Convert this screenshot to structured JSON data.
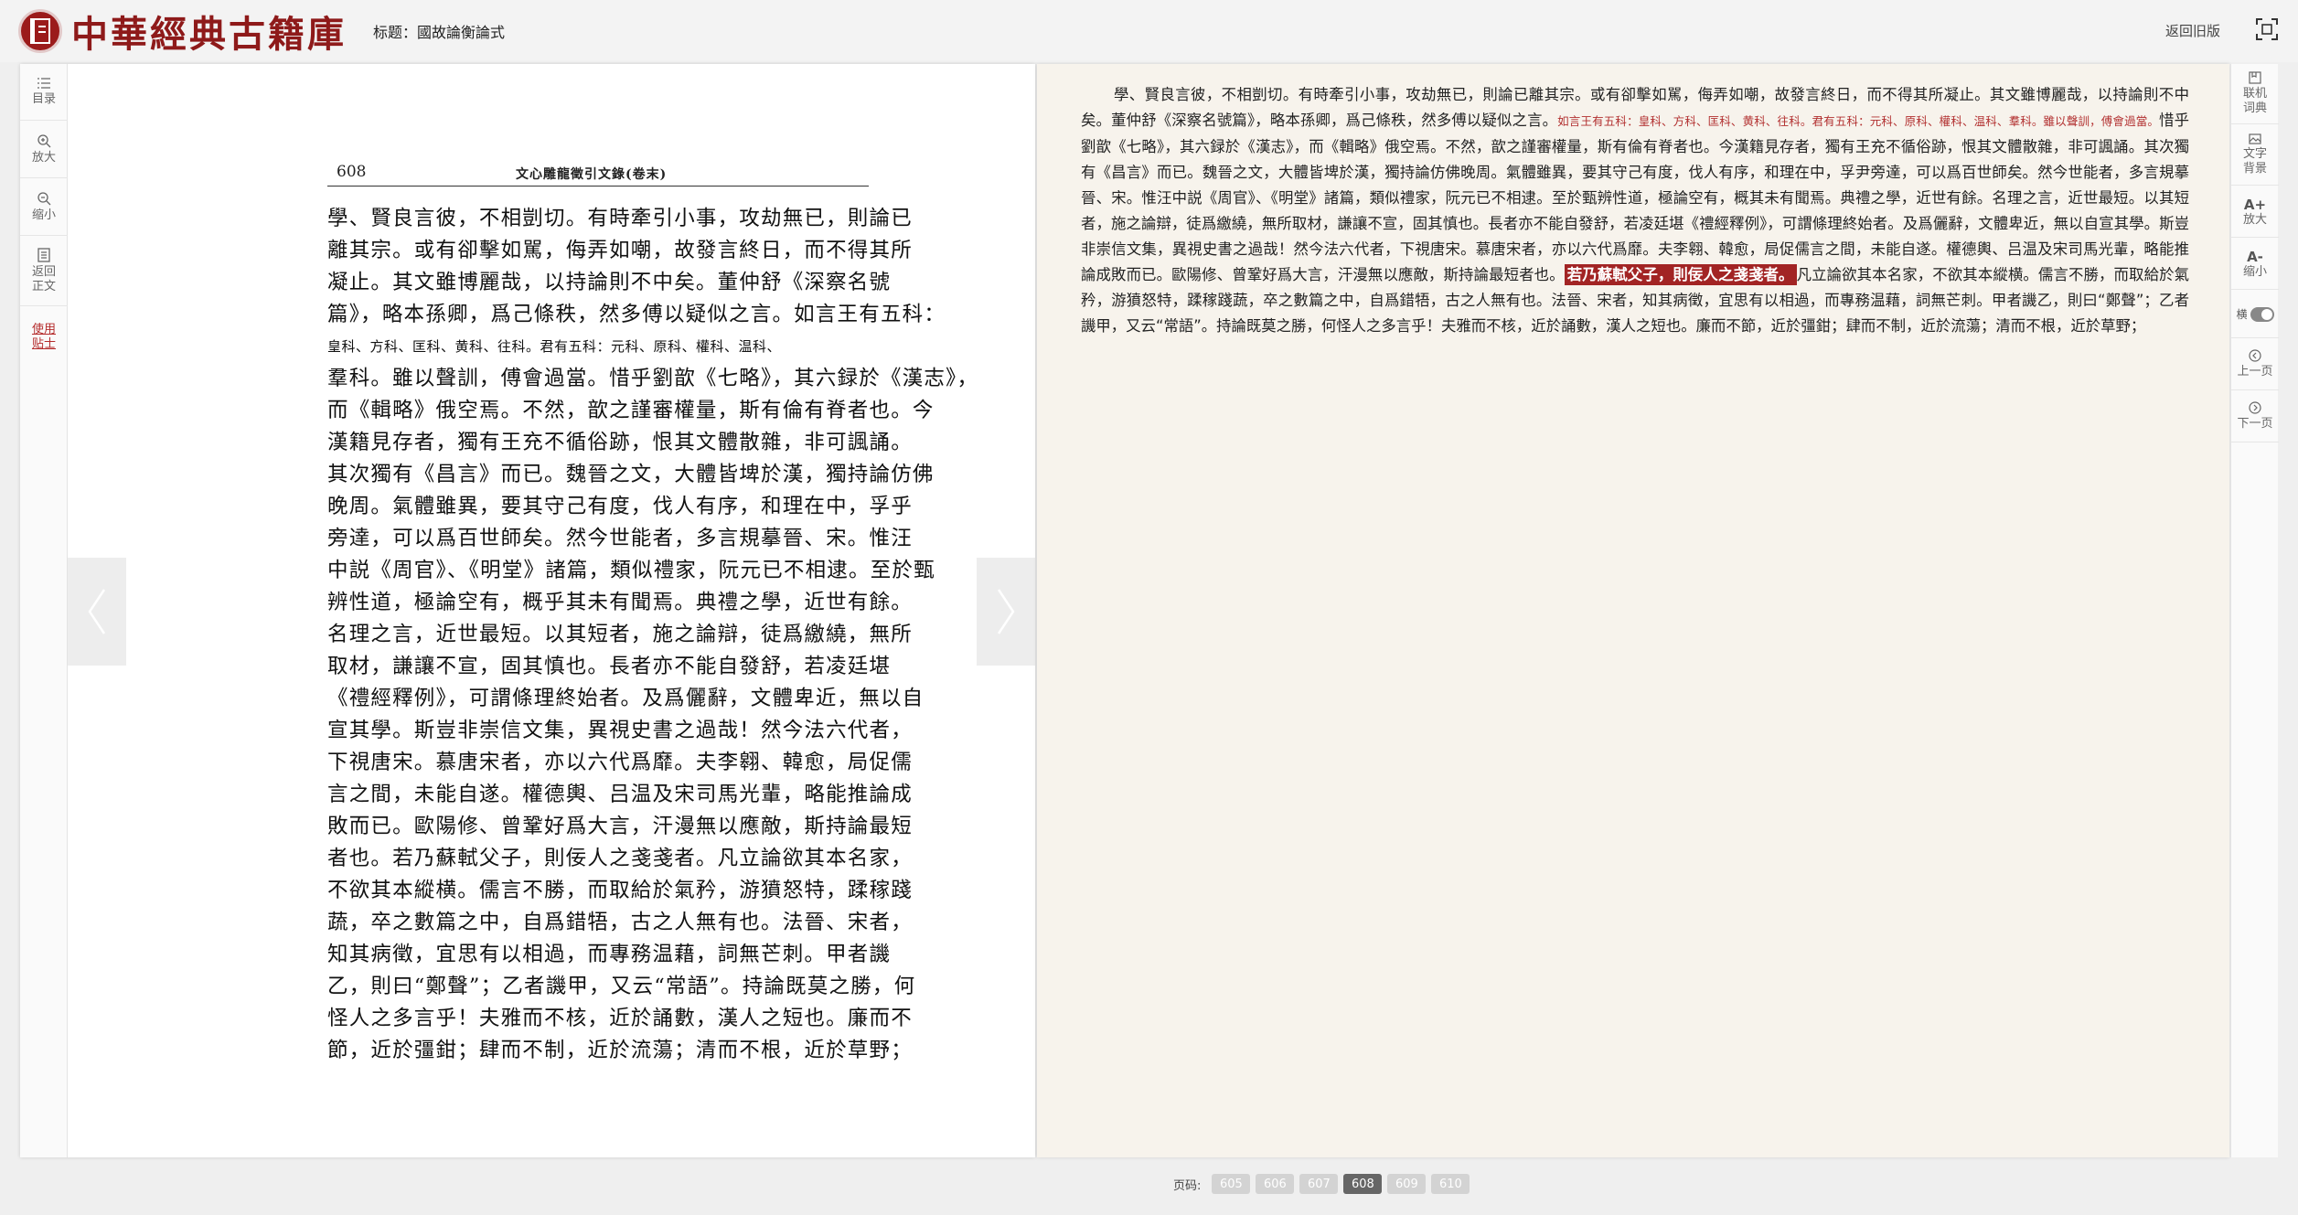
{
  "header": {
    "logo_text": "中華經典古籍庫",
    "doc_title": "标题：國故論衡論式",
    "back_old": "返回旧版"
  },
  "left_tools": [
    {
      "label": "目录",
      "icon": "list-icon"
    },
    {
      "label": "放大",
      "icon": "zoom-in-icon"
    },
    {
      "label": "缩小",
      "icon": "zoom-out-icon"
    },
    {
      "label": "返回\n正文",
      "icon": "return-icon"
    },
    {
      "label": "使用\n贴士",
      "icon": "tips"
    }
  ],
  "right_tools": [
    {
      "label": "联机\n词典",
      "icon": "dictionary-icon"
    },
    {
      "label": "文字\n背景",
      "icon": "background-icon"
    },
    {
      "label": "放大",
      "icon": "font-larger-icon"
    },
    {
      "label": "缩小",
      "icon": "font-smaller-icon"
    },
    {
      "label": "横",
      "icon": "orientation-toggle"
    },
    {
      "label": "上一页",
      "icon": "prev-page-icon"
    },
    {
      "label": "下一页",
      "icon": "next-page-icon"
    }
  ],
  "scan": {
    "page_number": "608",
    "running_head": "文心雕龍徵引文錄(卷末)",
    "lines": [
      "學、賢良言彼，不相剴切。有時牽引小事，攻劫無已，則論已",
      "離其宗。或有卻擊如駡，侮弄如嘲，故發言終日，而不得其所",
      "凝止。其文雖博麗哉，以持論則不中矣。董仲舒《深察名號",
      "篇》，略本孫卿，爲己條秩，然多傅以疑似之言。如言王有五科：",
      "皇科、方科、匡科、黄科、往科。君有五科：元科、原科、權科、温科、",
      "羣科。雖以聲訓，傅會過當。惜乎劉歆《七略》，其六録於《漢志》，",
      "而《輯略》俄空焉。不然，歆之謹審權量，斯有倫有脊者也。今",
      "漢籍見存者，獨有王充不循俗跡，恨其文體散雜，非可諷誦。",
      "其次獨有《昌言》而已。魏晉之文，大體皆埤於漢，獨持論仿佛",
      "晚周。氣體雖異，要其守己有度，伐人有序，和理在中，孚乎",
      "旁達，可以爲百世師矣。然今世能者，多言規摹晉、宋。惟汪",
      "中説《周官》、《明堂》諸篇，類似禮家，阮元已不相逮。至於甄",
      "辨性道，極論空有，概乎其未有聞焉。典禮之學，近世有餘。",
      "名理之言，近世最短。以其短者，施之論辯，徒爲繳繞，無所",
      "取材，謙讓不宣，固其慎也。長者亦不能自發舒，若凌廷堪",
      "《禮經釋例》，可謂條理終始者。及爲儷辭，文體卑近，無以自",
      "宣其學。斯豈非崇信文集，異視史書之過哉！然今法六代者，",
      "下視唐宋。慕唐宋者，亦以六代爲靡。夫李翱、韓愈，局促儒",
      "言之間，未能自遂。權德輿、吕温及宋司馬光輩，略能推論成",
      "敗而已。歐陽修、曾鞏好爲大言，汗漫無以應敵，斯持論最短",
      "者也。若乃蘇軾父子，則佞人之戔戔者。凡立論欲其本名家，",
      "不欲其本縱横。儒言不勝，而取給於氣矜，游獖怒特，蹂稼踐",
      "蔬，卒之數篇之中，自爲錯牾，古之人無有也。法晉、宋者，",
      "知其病徵，宜思有以相過，而專務温藉，詞無芒刺。甲者譏",
      "乙，則曰“鄭聲”；乙者譏甲，又云“常語”。持論既莫之勝，何",
      "怪人之多言乎！夫雅而不核，近於誦數，漢人之短也。廉而不",
      "節，近於彊鉗；肆而不制，近於流蕩；清而不根，近於草野；"
    ]
  },
  "text": {
    "part1": "學、賢良言彼，不相剴切。有時牽引小事，攻劫無已，則論已離其宗。或有卻擊如駡，侮弄如嘲，故發言終日，而不得其所凝止。其文雖博麗哉，以持論則不中矣。董仲舒《深察名號篇》，略本孫卿，爲己條秩，然多傅以疑似之言。",
    "note": "如言王有五科：皇科、方科、匡科、黄科、往科。君有五科：元科、原科、權科、温科、羣科。雖以聲訓，傅會過當。",
    "part2": "惜乎劉歆《七略》，其六録於《漢志》，而《輯略》俄空焉。不然，歆之謹審權量，斯有倫有脊者也。今漢籍見存者，獨有王充不循俗跡，恨其文體散雜，非可諷誦。其次獨有《昌言》而已。魏晉之文，大體皆埤於漢，獨持論仿佛晚周。氣體雖異，要其守己有度，伐人有序，和理在中，孚尹旁達，可以爲百世師矣。然今世能者，多言規摹晉、宋。惟汪中説《周官》、《明堂》諸篇，類似禮家，阮元已不相逮。至於甄辨性道，極論空有，概其未有聞焉。典禮之學，近世有餘。名理之言，近世最短。以其短者，施之論辯，徒爲繳繞，無所取材，謙讓不宣，固其慎也。長者亦不能自發舒，若凌廷堪《禮經釋例》，可謂條理終始者。及爲儷辭，文體卑近，無以自宣其學。斯豈非崇信文集，異視史書之過哉！然今法六代者，下視唐宋。慕唐宋者，亦以六代爲靡。夫李翱、韓愈，局促儒言之間，未能自遂。權德輿、吕温及宋司馬光輩，略能推論成敗而已。歐陽修、曾鞏好爲大言，汗漫無以應敵，斯持論最短者也。",
    "highlight": "若乃蘇軾父子，則佞人之戔戔者。",
    "part3": "凡立論欲其本名家，不欲其本縱横。儒言不勝，而取給於氣矜，游獖怒特，蹂稼踐蔬，卒之數篇之中，自爲錯牾，古之人無有也。法晉、宋者，知其病徵，宜思有以相過，而專務温藉，詞無芒刺。甲者譏乙，則曰“鄭聲”；乙者譏甲，又云“常語”。持論既莫之勝，何怪人之多言乎！夫雅而不核，近於誦數，漢人之短也。廉而不節，近於彊鉗；肆而不制，近於流蕩；清而不根，近於草野；"
  },
  "pager": {
    "label": "页码:",
    "pages": [
      "605",
      "606",
      "607",
      "608",
      "609",
      "610"
    ],
    "current": "608"
  },
  "colors": {
    "brand": "#8e1a1a",
    "highlight": "#a22424",
    "note": "#b23030",
    "text_bg": "#f7f3ec"
  }
}
